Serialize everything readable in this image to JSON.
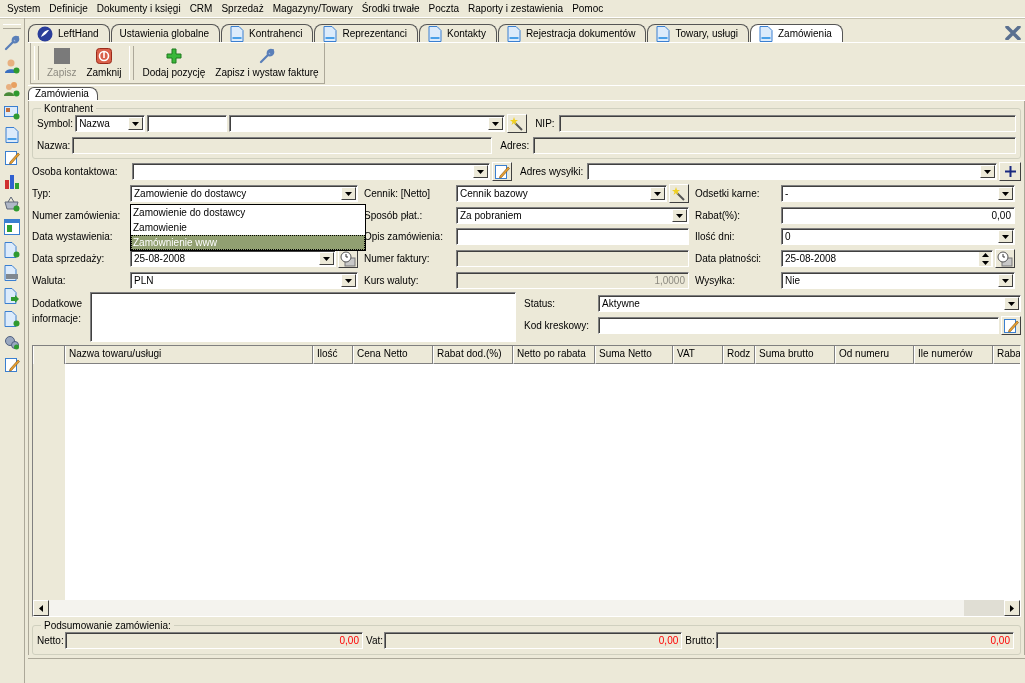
{
  "menu": [
    "System",
    "Definicje",
    "Dokumenty i księgi",
    "CRM",
    "Sprzedaż",
    "Magazyny/Towary",
    "Środki trwałe",
    "Poczta",
    "Raporty i zestawienia",
    "Pomoc"
  ],
  "tabs": [
    {
      "label": "LeftHand",
      "selected": false
    },
    {
      "label": "Ustawienia globalne",
      "selected": false
    },
    {
      "label": "Kontrahenci",
      "selected": false
    },
    {
      "label": "Reprezentanci",
      "selected": false
    },
    {
      "label": "Kontakty",
      "selected": false
    },
    {
      "label": "Rejestracja dokumentów",
      "selected": false
    },
    {
      "label": "Towary, usługi",
      "selected": false
    },
    {
      "label": "Zamówienia",
      "selected": true
    }
  ],
  "toolbar": [
    {
      "label": "Zapisz",
      "disabled": true
    },
    {
      "label": "Zamknij",
      "disabled": false
    },
    {
      "label": "Dodaj pozycję",
      "disabled": false
    },
    {
      "label": "Zapisz i wystaw fakturę",
      "disabled": false
    }
  ],
  "subtab": {
    "label": "Zamówienia",
    "selected": true
  },
  "kontrahent": {
    "title": "Kontrahent",
    "symbol_label": "Symbol:",
    "symbol_type": "Nazwa",
    "nip_label": "NIP:",
    "nazwa_label": "Nazwa:",
    "adres_label": "Adres:"
  },
  "contact": {
    "label": "Osoba kontaktowa:",
    "address_label": "Adres wysyłki:"
  },
  "details": [
    {
      "fields": [
        {
          "label": "Typ:",
          "kind": "combo",
          "value": "Zamowienie do dostawcy"
        },
        {
          "label": "Cennik: [Netto]",
          "kind": "wizardcombo",
          "value": "Cennik bazowy"
        },
        {
          "label": "Odsetki karne:",
          "kind": "combo",
          "value": "-"
        }
      ]
    },
    {
      "fields": [
        {
          "label": "Numer zamówienia:",
          "kind": "covered"
        },
        {
          "label": "Sposób płat.:",
          "kind": "combo",
          "value": "Za pobraniem"
        },
        {
          "label": "Rabat(%):",
          "kind": "number",
          "value": "0,00"
        }
      ]
    },
    {
      "fields": [
        {
          "label": "Data wystawienia:",
          "kind": "covered"
        },
        {
          "label": "Opis zamówienia:",
          "kind": "text"
        },
        {
          "label": "Ilość dni:",
          "kind": "combo",
          "value": "0"
        }
      ]
    },
    {
      "fields": [
        {
          "label": "Data sprzedaży:",
          "kind": "date",
          "value": "25-08-2008"
        },
        {
          "label": "Numer faktury:",
          "kind": "readonly"
        },
        {
          "label": "Data płatności:",
          "kind": "spin",
          "value": "25-08-2008"
        }
      ]
    },
    {
      "fields": [
        {
          "label": "Waluta:",
          "kind": "combo",
          "value": "PLN"
        },
        {
          "label": "Kurs waluty:",
          "kind": "readonlynumber",
          "value": "1,0000"
        },
        {
          "label": "Wysyłka:",
          "kind": "combo",
          "value": "Nie"
        }
      ]
    }
  ],
  "type_dropdown": {
    "options": [
      {
        "label": "Zamowienie do dostawcy",
        "selected": false
      },
      {
        "label": "Zamowienie",
        "selected": false
      },
      {
        "label": "Zamównienie www",
        "selected": true
      }
    ]
  },
  "extra": {
    "label": "Dodatkowe informacje:",
    "status_label": "Status:",
    "status": "Aktywne",
    "barcode_label": "Kod kreskowy:"
  },
  "table": {
    "columns": [
      "Nazwa towaru/usługi",
      "Ilość",
      "Cena Netto",
      "Rabat dod.(%)",
      "Netto po rabata",
      "Suma Netto",
      "VAT",
      "Rodz",
      "Suma brutto",
      "Od numeru",
      "Ile numerów",
      "Raba"
    ]
  },
  "summary": {
    "title": "Podsumowanie zamówienia:",
    "fields": [
      {
        "label": "Netto:",
        "value": "0,00"
      },
      {
        "label": "Vat:",
        "value": "0,00"
      },
      {
        "label": "Brutto:",
        "value": "0,00"
      }
    ]
  }
}
